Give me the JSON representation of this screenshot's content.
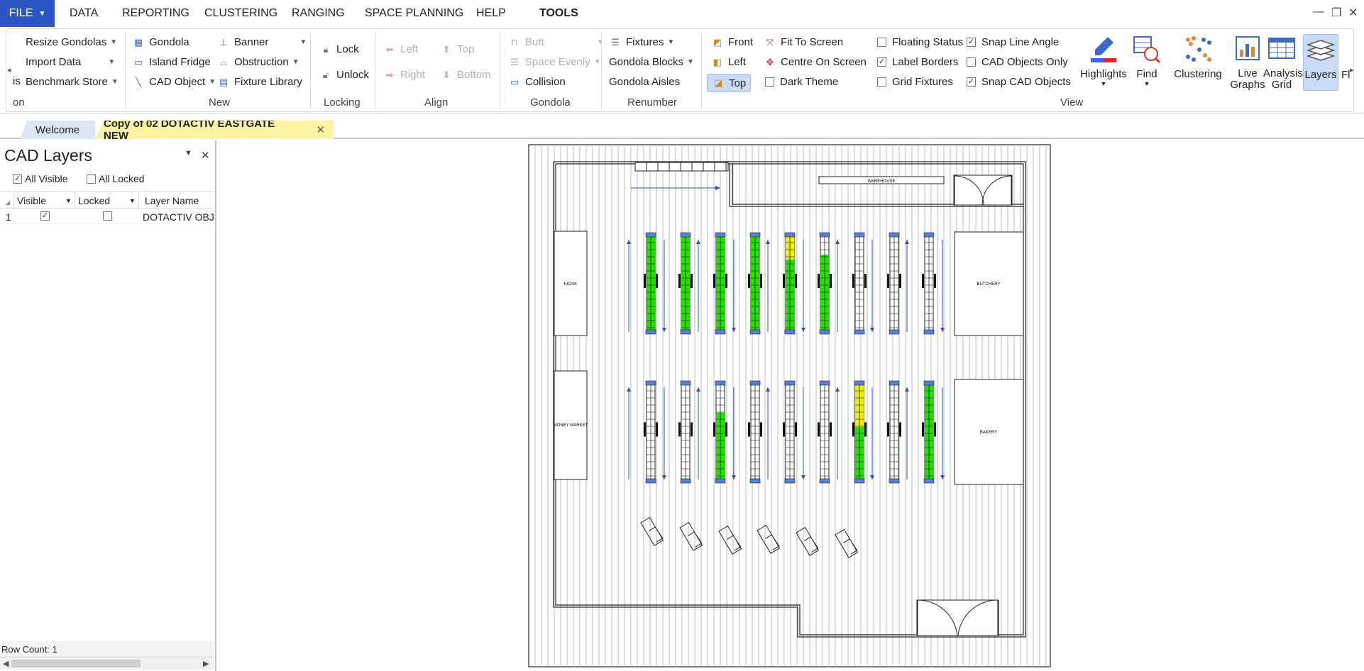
{
  "menu": {
    "file": "FILE",
    "items": [
      "DATA",
      "REPORTING",
      "CLUSTERING",
      "RANGING",
      "SPACE PLANNING",
      "HELP",
      "TOOLS"
    ],
    "active": "TOOLS"
  },
  "ribbon": {
    "partial_left": {
      "label": "is",
      "group": "on"
    },
    "groups": {
      "new": "New",
      "locking": "Locking",
      "align": "Align",
      "gondola": "Gondola",
      "renumber": "Renumber",
      "view": "View"
    },
    "col1": [
      "Resize Gondolas",
      "Import Data",
      "Benchmark Store"
    ],
    "new_a": [
      "Gondola",
      "Island Fridge",
      "CAD Object"
    ],
    "new_b": [
      "Banner",
      "Obstruction",
      "Fixture Library"
    ],
    "locking": [
      "Lock",
      "Unlock"
    ],
    "align_a": [
      "Left",
      "Right"
    ],
    "align_b": [
      "Top",
      "Bottom"
    ],
    "gondola": [
      "Butt",
      "Space Evenly",
      "Collision"
    ],
    "renumber": [
      "Fixtures",
      "Gondola Blocks",
      "Gondola Aisles"
    ],
    "view_a": [
      "Front",
      "Left",
      "Top"
    ],
    "view_b": [
      "Fit To Screen",
      "Centre On Screen",
      "Dark Theme"
    ],
    "view_c": [
      {
        "label": "Floating Status",
        "checked": false
      },
      {
        "label": "Label Borders",
        "checked": true
      },
      {
        "label": "Grid Fixtures",
        "checked": false
      }
    ],
    "view_d": [
      {
        "label": "Snap Line Angle",
        "checked": true
      },
      {
        "label": "CAD Objects Only",
        "checked": false
      },
      {
        "label": "Snap CAD Objects",
        "checked": true
      }
    ],
    "big": [
      {
        "label": "Highlights",
        "icon": "highlights-icon"
      },
      {
        "label": "Find",
        "icon": "find-icon"
      },
      {
        "label": "Clustering",
        "icon": "clustering-icon"
      },
      {
        "label": "Live Graphs",
        "icon": "live-graphs-icon"
      },
      {
        "label": "Analysis Grid",
        "icon": "analysis-grid-icon"
      },
      {
        "label": "Layers",
        "icon": "layers-icon"
      }
    ],
    "partial_right": "Fl"
  },
  "tabs": {
    "welcome": "Welcome",
    "document": "Copy of 02 DOTACTIV EASTGATE NEW",
    "close": "✕"
  },
  "panel": {
    "title": "CAD Layers",
    "all_visible": "All Visible",
    "all_locked": "All Locked",
    "columns": [
      "Visible",
      "Locked",
      "Layer Name"
    ],
    "rows": [
      {
        "num": "1",
        "visible": true,
        "locked": false,
        "name": "DOTACTIV OBJE"
      }
    ],
    "row_count": "Row Count: 1"
  },
  "floor": {
    "labels": {
      "warehouse": "WAREHOUSE",
      "kiosk": "KIOSK",
      "money_market": "MONEY MARKET",
      "butchery": "BUTCHERY",
      "bakery": "BAKERY"
    },
    "colors": {
      "green": "#22e000",
      "yellow": "#f0f000",
      "cap": "#5b7fd6",
      "arrow": "#2f4fc0"
    },
    "top_row": [
      1,
      1,
      1,
      1,
      0.75,
      0.8,
      0,
      0,
      0
    ],
    "bottom_row": [
      0,
      0,
      0.7,
      0,
      0,
      0,
      1,
      0,
      1
    ],
    "top_yellow": [
      0,
      0,
      0,
      0,
      0.25,
      0,
      0,
      0,
      0
    ],
    "bottom_yellow": [
      0,
      0,
      0,
      0,
      0,
      0,
      0.45,
      0,
      0
    ]
  }
}
